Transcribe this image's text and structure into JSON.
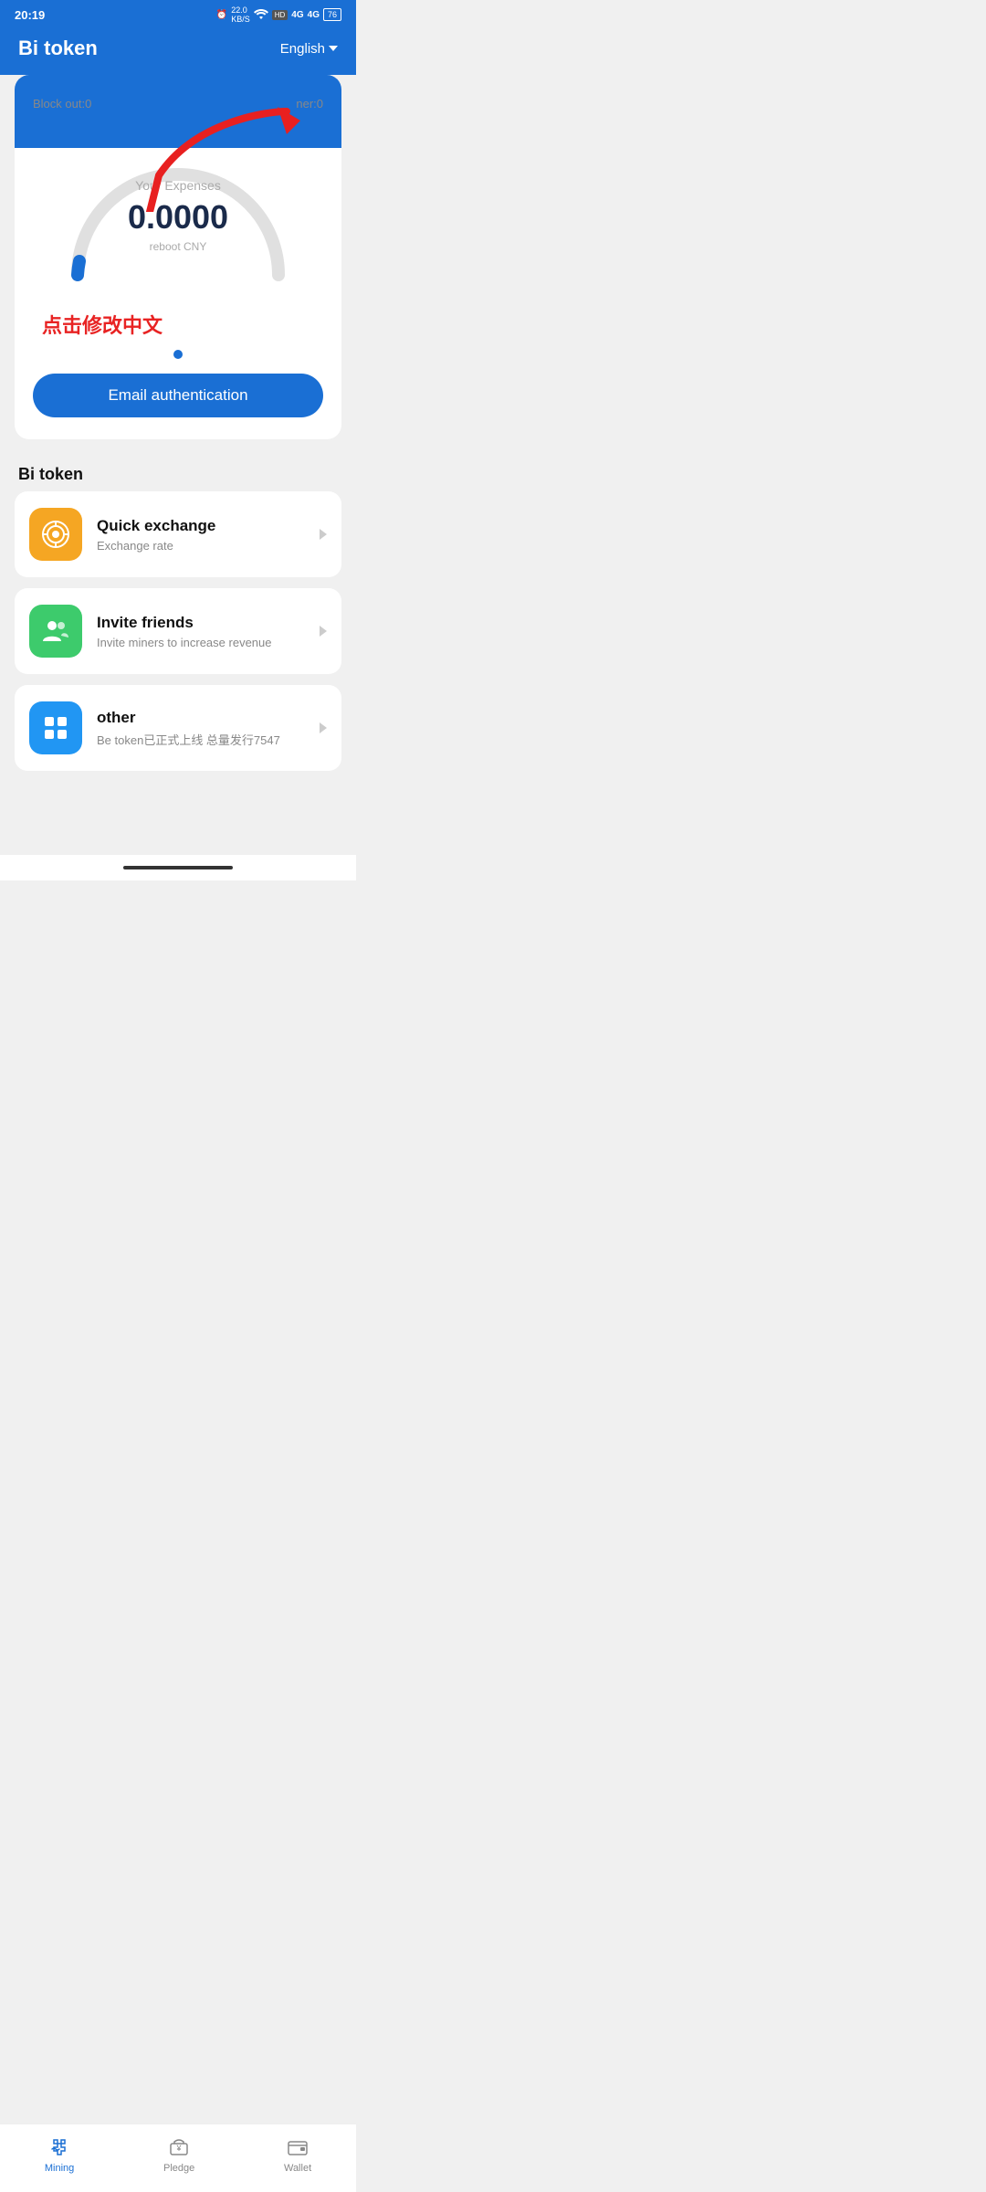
{
  "statusBar": {
    "time": "20:19",
    "icons": "⏰ 22.0 KB/S ⟨wifi⟩ HD 4G 4G 76"
  },
  "header": {
    "title": "Bi token",
    "language": "English",
    "chevron": "▼"
  },
  "card": {
    "blockOut": "Block out:0",
    "miner": "ner:0",
    "expensesLabel": "Your Expenses",
    "expensesAmount": "0.0000",
    "expensesSub": "reboot CNY",
    "chineseAnnotation": "点击修改中文",
    "emailAuthButton": "Email authentication"
  },
  "sectionTitle": "Bi token",
  "listItems": [
    {
      "title": "Quick exchange",
      "sub": "Exchange rate",
      "iconColor": "orange"
    },
    {
      "title": "Invite friends",
      "sub": "Invite miners to increase revenue",
      "iconColor": "green"
    },
    {
      "title": "other",
      "sub": "Be token已正式上线 总量发行7547",
      "iconColor": "blue"
    }
  ],
  "bottomNav": [
    {
      "label": "Mining",
      "active": true
    },
    {
      "label": "Pledge",
      "active": false
    },
    {
      "label": "Wallet",
      "active": false
    }
  ]
}
